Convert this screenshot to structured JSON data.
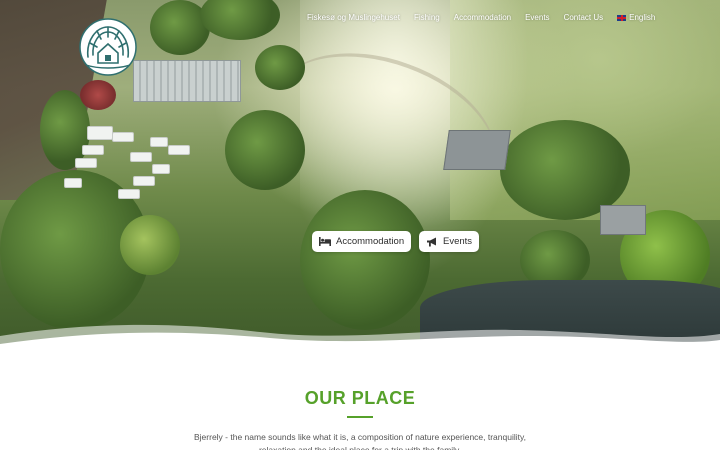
{
  "nav": {
    "items": [
      {
        "label": "Fiskesø og Muslingehuset"
      },
      {
        "label": "Fishing"
      },
      {
        "label": "Accommodation"
      },
      {
        "label": "Events"
      },
      {
        "label": "Contact Us"
      }
    ],
    "language": "English",
    "language_icon": "uk-flag-icon"
  },
  "hero": {
    "buttons": [
      {
        "label": "Accommodation",
        "icon": "bed-icon"
      },
      {
        "label": "Events",
        "icon": "megaphone-icon"
      }
    ]
  },
  "content": {
    "title": "OUR PLACE",
    "intro": "Bjerrely - the name sounds like what it is, a composition of nature experience, tranquility, relaxation and the ideal place for a trip with the family."
  },
  "colors": {
    "accent": "#56a12a",
    "text": "#555555",
    "nav_text": "#ffffff"
  }
}
